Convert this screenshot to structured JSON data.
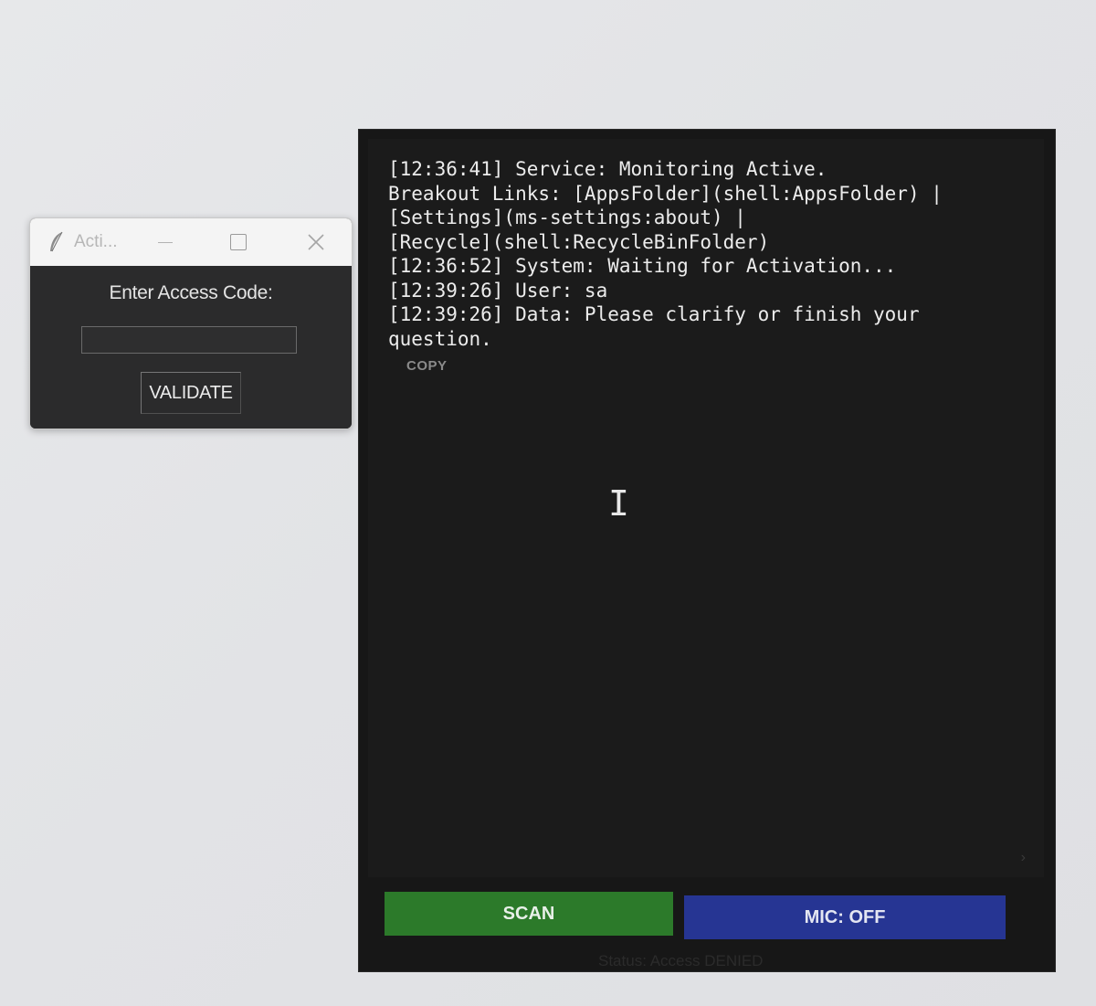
{
  "dialog": {
    "title": "Acti...",
    "icon": "feather-icon",
    "label": "Enter Access Code:",
    "input_value": "",
    "button_label": "VALIDATE"
  },
  "terminal": {
    "lines": [
      "[12:36:41] Service: Monitoring Active.",
      "Breakout Links: [AppsFolder](shell:AppsFolder) |",
      "[Settings](ms-settings:about) |",
      "[Recycle](shell:RecycleBinFolder)",
      "[12:36:52] System: Waiting for Activation...",
      "[12:39:26] User: sa",
      "[12:39:26] Data: Please clarify or finish your",
      "question."
    ],
    "copy_label": "COPY",
    "cursor_glyph": "I",
    "scan_label": "SCAN",
    "mic_label": "MIC: OFF",
    "status": "Status: Access DENIED"
  },
  "colors": {
    "scan": "#2c7a2a",
    "mic": "#263593",
    "terminal_bg": "#1b1b1b"
  }
}
